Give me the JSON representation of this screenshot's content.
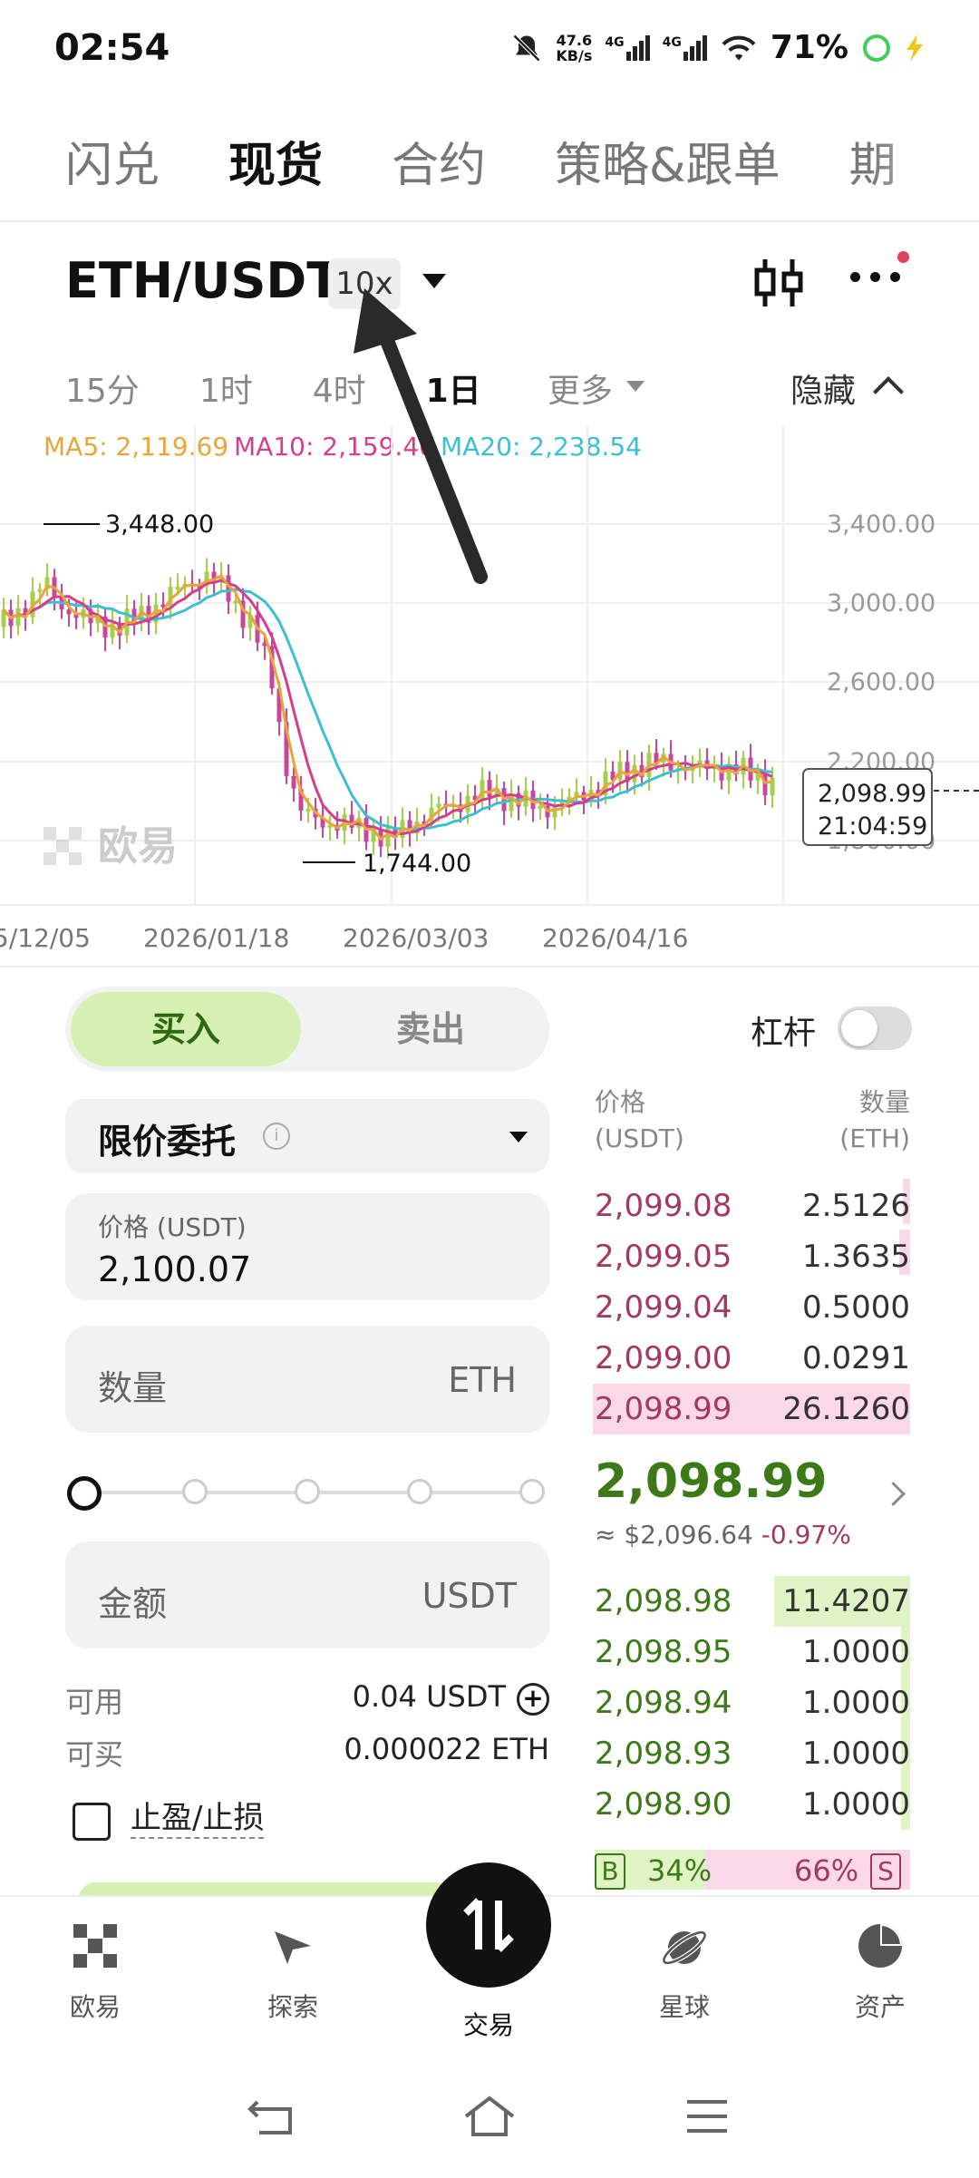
{
  "status_bar": {
    "time": "02:54",
    "net_speed_top": "47.6",
    "net_speed_bottom": "KB/s",
    "signal1": "4G",
    "signal2": "4G",
    "battery": "71%"
  },
  "top_tabs": [
    {
      "label": "闪兑",
      "active": false
    },
    {
      "label": "现货",
      "active": true
    },
    {
      "label": "合约",
      "active": false
    },
    {
      "label": "策略&跟单",
      "active": false
    },
    {
      "label": "期",
      "active": false
    }
  ],
  "pair": {
    "symbol": "ETH/USDT",
    "leverage": "10x"
  },
  "intervals": {
    "items": [
      "15分",
      "1时",
      "4时",
      "1日"
    ],
    "active_index": 3,
    "more": "更多",
    "hide": "隐藏"
  },
  "ma_legend": {
    "ma5": "MA5: 2,119.69",
    "ma10": "MA10: 2,159.40",
    "ma20": "MA20: 2,238.54",
    "ma5_color": "#e8a53a",
    "ma10_color": "#d43f8d",
    "ma20_color": "#3cbfd0"
  },
  "chart": {
    "high_label": "3,448.00",
    "low_label": "1,744.00",
    "y_ticks": [
      "3,400.00",
      "3,000.00",
      "2,600.00",
      "2,200.00",
      "1,800.00"
    ],
    "x_ticks": [
      "5/12/05",
      "2026/01/18",
      "2026/03/03",
      "2026/04/16"
    ],
    "last_price": "2,098.99",
    "countdown": "21:04:59",
    "watermark": "欧易",
    "up_color": "#a6d04a",
    "down_color": "#c9479b"
  },
  "chart_data": {
    "type": "line",
    "title": "",
    "xlabel": "",
    "ylabel": "",
    "ylim": [
      1600,
      3600
    ],
    "x": [
      "5/12/05",
      "2026/01/18",
      "2026/03/03",
      "2026/04/16"
    ],
    "series": [
      {
        "name": "MA5: 2,119.69",
        "values": [
          2900,
          3030,
          1880,
          2060
        ]
      },
      {
        "name": "MA10: 2,159.40",
        "values": [
          2920,
          3040,
          1900,
          2080
        ]
      },
      {
        "name": "MA20: 2,238.54",
        "values": [
          2950,
          3050,
          1950,
          2100
        ]
      }
    ],
    "annotations": [
      "3,448.00",
      "1,744.00",
      "2,098.99"
    ]
  },
  "trade": {
    "buy_label": "买入",
    "sell_label": "卖出",
    "leverage_label": "杠杆",
    "order_type": "限价委托",
    "price_label": "价格 (USDT)",
    "price_value": "2,100.07",
    "qty_label": "数量",
    "qty_unit": "ETH",
    "amount_label": "金额",
    "amount_unit": "USDT",
    "available_label": "可用",
    "available_value": "0.04 USDT",
    "buyable_label": "可买",
    "buyable_value": "0.000022 ETH",
    "tpsl_label": "止盈/止损"
  },
  "order_book": {
    "price_header": "价格",
    "price_unit": "(USDT)",
    "qty_header": "数量",
    "qty_unit": "(ETH)",
    "asks": [
      {
        "price": "2,099.08",
        "qty": "2.5126"
      },
      {
        "price": "2,099.05",
        "qty": "1.3635"
      },
      {
        "price": "2,099.04",
        "qty": "0.5000"
      },
      {
        "price": "2,099.00",
        "qty": "0.0291"
      },
      {
        "price": "2,098.99",
        "qty": "26.1260"
      }
    ],
    "mid_price": "2,098.99",
    "mid_usd": "≈ $2,096.64",
    "mid_change": "-0.97%",
    "bids": [
      {
        "price": "2,098.98",
        "qty": "11.4207"
      },
      {
        "price": "2,098.95",
        "qty": "1.0000"
      },
      {
        "price": "2,098.94",
        "qty": "1.0000"
      },
      {
        "price": "2,098.93",
        "qty": "1.0000"
      },
      {
        "price": "2,098.90",
        "qty": "1.0000"
      }
    ],
    "buy_ratio_tag": "B",
    "buy_ratio": "34%",
    "sell_ratio": "66%",
    "sell_ratio_tag": "S"
  },
  "bottom_nav": [
    {
      "label": "欧易",
      "icon": "okx-logo-icon"
    },
    {
      "label": "探索",
      "icon": "compass-icon"
    },
    {
      "label": "交易",
      "icon": "trade-swap-icon"
    },
    {
      "label": "星球",
      "icon": "planet-icon"
    },
    {
      "label": "资产",
      "icon": "pie-chart-icon"
    }
  ]
}
